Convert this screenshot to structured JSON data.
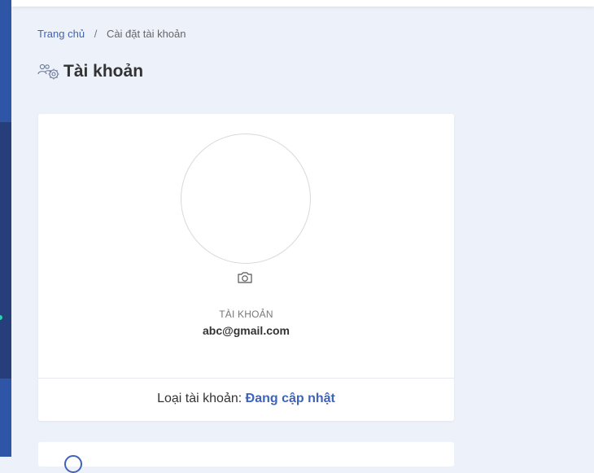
{
  "breadcrumb": {
    "home": "Trang chủ",
    "separator": "/",
    "current": "Cài đặt tài khoản"
  },
  "page": {
    "title": "Tài khoản",
    "title_icon": "users-gear-icon"
  },
  "profile": {
    "account_label": "TÀI KHOẢN",
    "email": "abc@gmail.com",
    "camera_icon": "camera-icon"
  },
  "account_type": {
    "label": "Loại tài khoản:",
    "value": "Đang cập nhật"
  },
  "colors": {
    "accent": "#3f63b8",
    "sidebar": "#2e4b8f",
    "background": "#edf1f9",
    "indicator": "#27d3b0"
  }
}
